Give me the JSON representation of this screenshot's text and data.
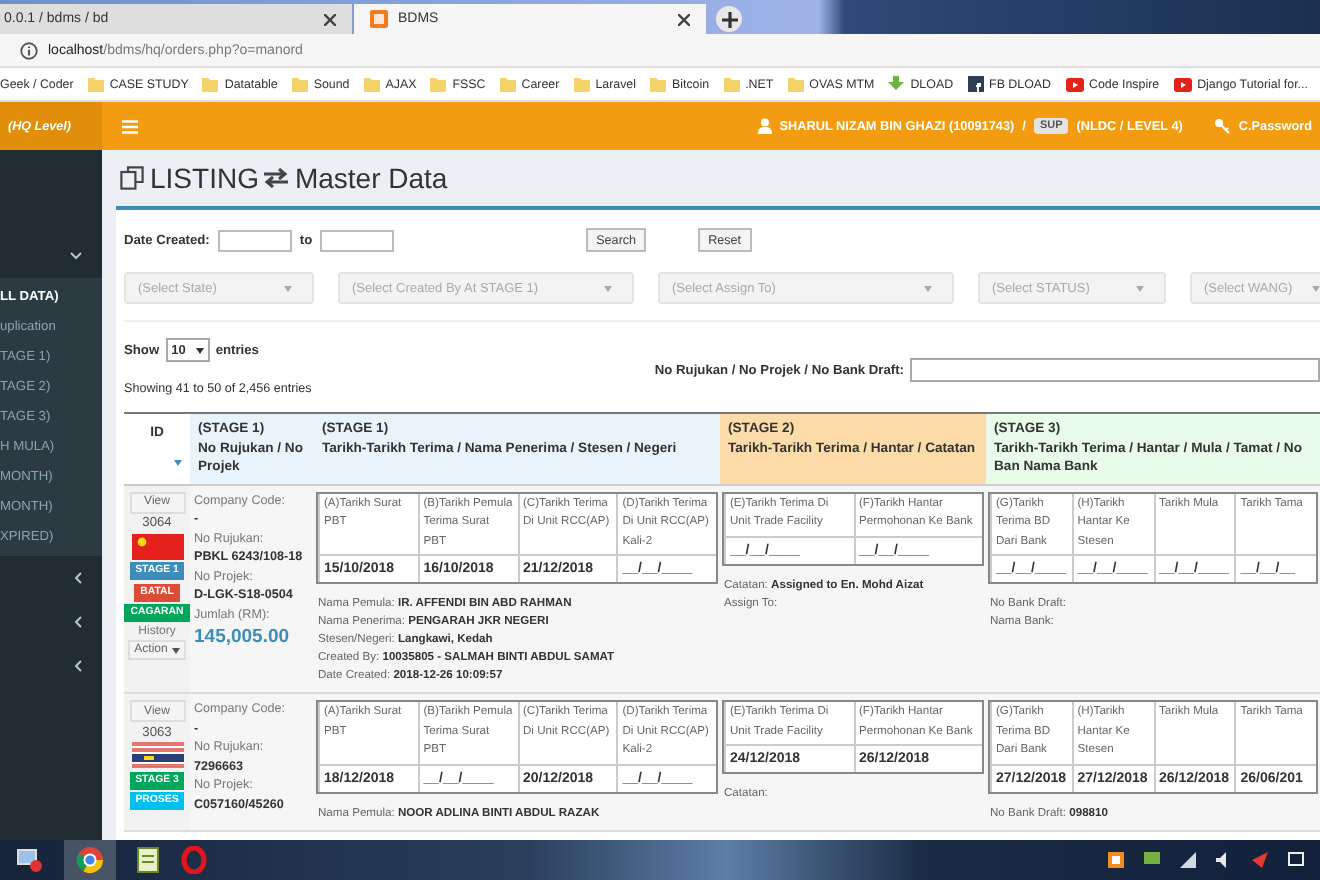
{
  "browser": {
    "tabs": [
      {
        "title": "0.0.1 / bdms / bd",
        "selected": false
      },
      {
        "title": "BDMS",
        "selected": true
      }
    ],
    "address": "**localhost**/bdms/hq/orders.php?o=manord",
    "bookmarks": [
      {
        "kind": "plain",
        "label": "Geek / Coder"
      },
      {
        "kind": "folder",
        "label": "CASE STUDY"
      },
      {
        "kind": "folder",
        "label": "Datatable"
      },
      {
        "kind": "folder",
        "label": "Sound"
      },
      {
        "kind": "folder",
        "label": "AJAX"
      },
      {
        "kind": "folder",
        "label": "FSSC"
      },
      {
        "kind": "folder",
        "label": "Career"
      },
      {
        "kind": "folder",
        "label": "Laravel"
      },
      {
        "kind": "folder",
        "label": "Bitcoin"
      },
      {
        "kind": "folder",
        "label": ".NET"
      },
      {
        "kind": "folder",
        "label": "OVAS MTM"
      },
      {
        "kind": "download",
        "label": "DLOAD"
      },
      {
        "kind": "square",
        "label": "FB DLOAD"
      },
      {
        "kind": "video",
        "label": "Code Inspire"
      },
      {
        "kind": "video",
        "label": "Django Tutorial for..."
      }
    ]
  },
  "header": {
    "brand": "(HQ Level)",
    "user": "SHARUL NIZAM BIN GHAZI (10091743)",
    "separator": "/",
    "role_badge": "SUP",
    "level": "(NLDC / LEVEL 4)",
    "password_link": "C.Password"
  },
  "sidebar": {
    "groups": [
      {
        "expanded": true,
        "items": [
          {
            "label": "LL DATA)",
            "selected": true
          },
          {
            "label": "uplication",
            "selected": false
          },
          {
            "label": "TAGE 1)",
            "selected": false
          },
          {
            "label": "TAGE 2)",
            "selected": false
          },
          {
            "label": "TAGE 3)",
            "selected": false
          },
          {
            "label": "H MULA)",
            "selected": false
          },
          {
            "label": "MONTH)",
            "selected": false
          },
          {
            "label": "MONTH)",
            "selected": false
          },
          {
            "label": "XPIRED)",
            "selected": false
          }
        ]
      },
      {
        "expanded": false
      },
      {
        "expanded": false
      },
      {
        "expanded": false
      }
    ]
  },
  "page": {
    "title": "LISTING",
    "subtitle": "Master Data"
  },
  "filters": {
    "date_label": "Date Created:",
    "to_label": "to",
    "search_button": "Search",
    "reset_button": "Reset",
    "selects": [
      "(Select State)",
      "(Select Created By At STAGE 1)",
      "(Select Assign To)",
      "(Select STATUS)",
      "(Select WANG)"
    ],
    "show_label": "Show",
    "page_size": "10",
    "entries_label": "entries",
    "search_label": "No Rujukan / No Projek / No Bank Draft:",
    "info": "Showing 41 to 50 of 2,456 entries"
  },
  "table": {
    "id_header": "ID",
    "columns": [
      {
        "stage": "(STAGE 1)",
        "title": "No Rujukan / No Projek",
        "color": "#eaf4fc"
      },
      {
        "stage": "(STAGE 1)",
        "title": "Tarikh-Tarikh Terima / Nama Penerima / Stesen / Negeri",
        "color": "#eaf4fc"
      },
      {
        "stage": "(STAGE 2)",
        "title": "Tarikh-Tarikh Terima / Hantar / Catatan",
        "color": "#fddcaa"
      },
      {
        "stage": "(STAGE 3)",
        "title": "Tarikh-Tarikh Terima / Hantar / Mula / Tamat / No Ban Nama Bank",
        "color": "#e9fbe9"
      }
    ],
    "rows": [
      {
        "view": "View",
        "id": "3064",
        "flag": {
          "kind": "red"
        },
        "badges": [
          {
            "text": "STAGE 1",
            "color": "#3c8dbc"
          },
          {
            "text": "BATAL",
            "color": "#dd4b39"
          },
          {
            "text": "CAGARAN",
            "color": "#00a65a"
          }
        ],
        "history": "History",
        "action": "Action",
        "fields": [
          {
            "label": "Company Code:",
            "value": "-"
          },
          {
            "label": "No Rujukan:",
            "value": "PBKL 6243/108-18"
          },
          {
            "label": "No Projek:",
            "value": "D-LGK-S18-0504"
          }
        ],
        "amount_label": "Jumlah (RM):",
        "amount": "145,005.00",
        "stages": [
          {
            "dates": [
              {
                "label": "(A)Tarikh Surat PBT",
                "value": "15/10/2018"
              },
              {
                "label": "(B)Tarikh Pemula Terima Surat PBT",
                "value": "16/10/2018"
              },
              {
                "label": "(C)Tarikh Terima Di Unit RCC(AP)",
                "value": "21/12/2018"
              },
              {
                "label": "(D)Tarikh Terima Di Unit RCC(AP) Kali-2",
                "value": "__/__/____"
              }
            ],
            "details": [
              {
                "label": "Nama Pemula:",
                "value": "IR. AFFENDI BIN ABD RAHMAN"
              },
              {
                "label": "Nama Penerima:",
                "value": "PENGARAH JKR NEGERI"
              },
              {
                "label": "Stesen/Negeri:",
                "value": "Langkawi, Kedah"
              },
              {
                "label": "Created By:",
                "value": "10035805 - SALMAH BINTI ABDUL SAMAT"
              },
              {
                "label": "Date Created:",
                "value": "2018-12-26 10:09:57"
              }
            ]
          },
          {
            "dates": [
              {
                "label": "(E)Tarikh Terima Di Unit Trade Facility",
                "value": "__/__/____"
              },
              {
                "label": "(F)Tarikh Hantar Permohonan Ke Bank",
                "value": "__/__/____"
              }
            ],
            "details": [
              {
                "label": "Catatan:",
                "value": "Assigned to En. Mohd Aizat"
              },
              {
                "label": "Assign To:"
              }
            ]
          },
          {
            "dates": [
              {
                "label": "(G)Tarikh Terima BD Dari Bank",
                "value": "__/__/____"
              },
              {
                "label": "(H)Tarikh Hantar Ke Stesen",
                "value": "__/__/____"
              },
              {
                "label": "Tarikh Mula",
                "value": "__/__/____"
              },
              {
                "label": "Tarikh Tama",
                "value": "__/__/__"
              }
            ],
            "details": [
              {
                "label": "No Bank Draft:"
              },
              {
                "label": "Nama Bank:"
              }
            ]
          }
        ]
      },
      {
        "view": "View",
        "id": "3063",
        "flag": {
          "kind": "stripes"
        },
        "badges": [
          {
            "text": "STAGE 3",
            "color": "#00a65a"
          },
          {
            "text": "PROSES",
            "color": "#00c0ef"
          }
        ],
        "fields": [
          {
            "label": "Company Code:",
            "value": "-"
          },
          {
            "label": "No Rujukan:",
            "value": "7296663"
          },
          {
            "label": "No Projek:",
            "value": "C057160/45260"
          }
        ],
        "stages": [
          {
            "dates": [
              {
                "label": "(A)Tarikh Surat PBT",
                "value": "18/12/2018"
              },
              {
                "label": "(B)Tarikh Pemula Terima Surat PBT",
                "value": "__/__/____"
              },
              {
                "label": "(C)Tarikh Terima Di Unit RCC(AP)",
                "value": "20/12/2018"
              },
              {
                "label": "(D)Tarikh Terima Di Unit RCC(AP) Kali-2",
                "value": "__/__/____"
              }
            ],
            "details": [
              {
                "label": "Nama Pemula:",
                "value": "NOOR ADLINA BINTI ABDUL RAZAK"
              }
            ]
          },
          {
            "dates": [
              {
                "label": "(E)Tarikh Terima Di Unit Trade Facility",
                "value": "24/12/2018"
              },
              {
                "label": "(F)Tarikh Hantar Permohonan Ke Bank",
                "value": "26/12/2018"
              }
            ],
            "details": [
              {
                "label": "Catatan:"
              }
            ]
          },
          {
            "dates": [
              {
                "label": "(G)Tarikh Terima BD Dari Bank",
                "value": "27/12/2018"
              },
              {
                "label": "(H)Tarikh Hantar Ke Stesen",
                "value": "27/12/2018"
              },
              {
                "label": "Tarikh Mula",
                "value": "26/12/2018"
              },
              {
                "label": "Tarikh Tama",
                "value": "26/06/201"
              }
            ],
            "details": [
              {
                "label": "No Bank Draft:",
                "value": "098810"
              }
            ]
          }
        ]
      }
    ]
  }
}
